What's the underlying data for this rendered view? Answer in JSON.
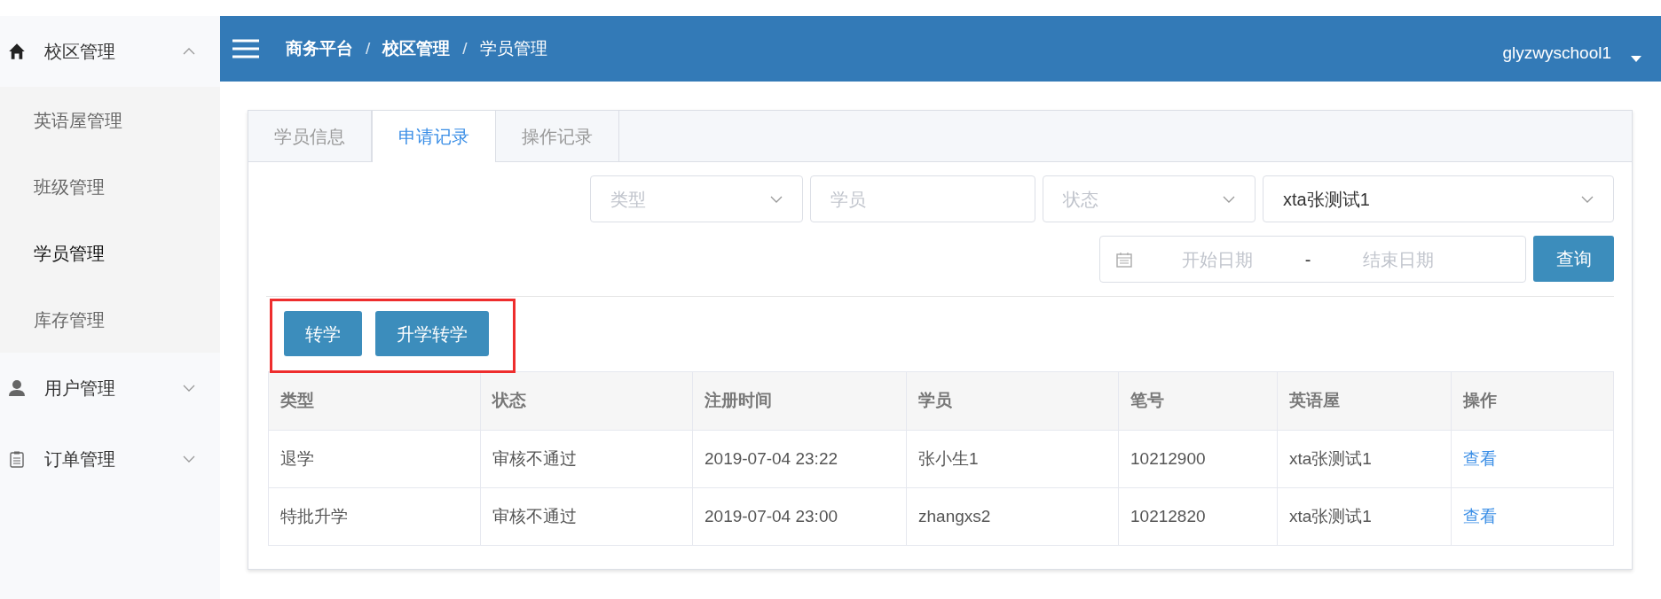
{
  "sidebar": {
    "items": [
      {
        "label": "校区管理",
        "kind": "home",
        "expanded": true,
        "children": [
          {
            "label": "英语屋管理",
            "selected": false
          },
          {
            "label": "班级管理",
            "selected": false
          },
          {
            "label": "学员管理",
            "selected": true
          },
          {
            "label": "库存管理",
            "selected": false
          }
        ]
      },
      {
        "label": "用户管理",
        "kind": "user",
        "expanded": false
      },
      {
        "label": "订单管理",
        "kind": "clipboard",
        "expanded": false
      }
    ]
  },
  "header": {
    "breadcrumb": [
      {
        "label": "商务平台",
        "current": false
      },
      {
        "label": "校区管理",
        "current": false
      },
      {
        "label": "学员管理",
        "current": true
      }
    ],
    "separator": "/",
    "user": "glyzwyschool1"
  },
  "tabs": [
    {
      "label": "学员信息",
      "selected": false
    },
    {
      "label": "申请记录",
      "selected": true
    },
    {
      "label": "操作记录",
      "selected": false
    }
  ],
  "filters": [
    {
      "kind": "select",
      "placeholder": "类型"
    },
    {
      "kind": "text",
      "placeholder": "学员"
    },
    {
      "kind": "select",
      "placeholder": "状态"
    },
    {
      "kind": "select",
      "value": "xta张测试1"
    }
  ],
  "date_range": {
    "start_placeholder": "开始日期",
    "separator": "-",
    "end_placeholder": "结束日期"
  },
  "query_button": "查询",
  "actions": [
    "转学",
    "升学转学"
  ],
  "table": {
    "columns": [
      "类型",
      "状态",
      "注册时间",
      "学员",
      "笔号",
      "英语屋",
      "操作"
    ],
    "rows": [
      [
        "退学",
        "审核不通过",
        "2019-07-04 23:22",
        "张小生1",
        "10212900",
        "xta张测试1",
        "查看"
      ],
      [
        "特批升学",
        "审核不通过",
        "2019-07-04 23:00",
        "zhangxs2",
        "10212820",
        "xta张测试1",
        "查看"
      ]
    ]
  }
}
